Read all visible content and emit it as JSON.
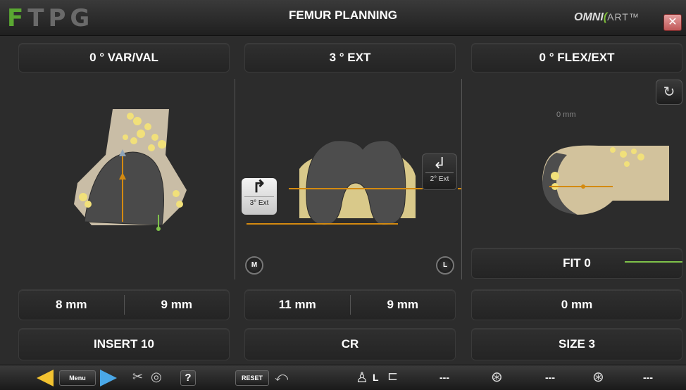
{
  "header": {
    "logo_letters": [
      "F",
      "T",
      "P",
      "G"
    ],
    "title": "FEMUR PLANNING",
    "brand_main": "OMNI",
    "brand_art": "ART",
    "brand_tm": "™"
  },
  "columns": [
    {
      "top_label": "0 ° VAR/VAL",
      "measure_left": "8 mm",
      "measure_right": "9 mm",
      "bottom_label": "INSERT 10"
    },
    {
      "top_label": "3 ° EXT",
      "measure_left": "11 mm",
      "measure_right": "9 mm",
      "bottom_label": "CR",
      "left_rotation_label": "3° Ext",
      "right_rotation_label": "2° Ext",
      "medial_marker": "M",
      "lateral_marker": "L"
    },
    {
      "top_label": "0 ° FLEX/EXT",
      "offset_label": "0 mm",
      "fit_label": "FIT 0",
      "measure_single": "0 mm",
      "bottom_label": "SIZE 3"
    }
  ],
  "toolbar": {
    "menu_label": "Menu",
    "reset_label": "RESET",
    "help_label": "?",
    "side_label": "L",
    "dash1": "---",
    "dash2": "---",
    "dash3": "---"
  },
  "colors": {
    "accent_orange": "#d48a10",
    "bone": "#c9bda6",
    "implant": "#4a4a4a",
    "cement_yellow": "#f1e07a",
    "fit_line": "#7fc24a",
    "logo_green": "#5aa832"
  }
}
